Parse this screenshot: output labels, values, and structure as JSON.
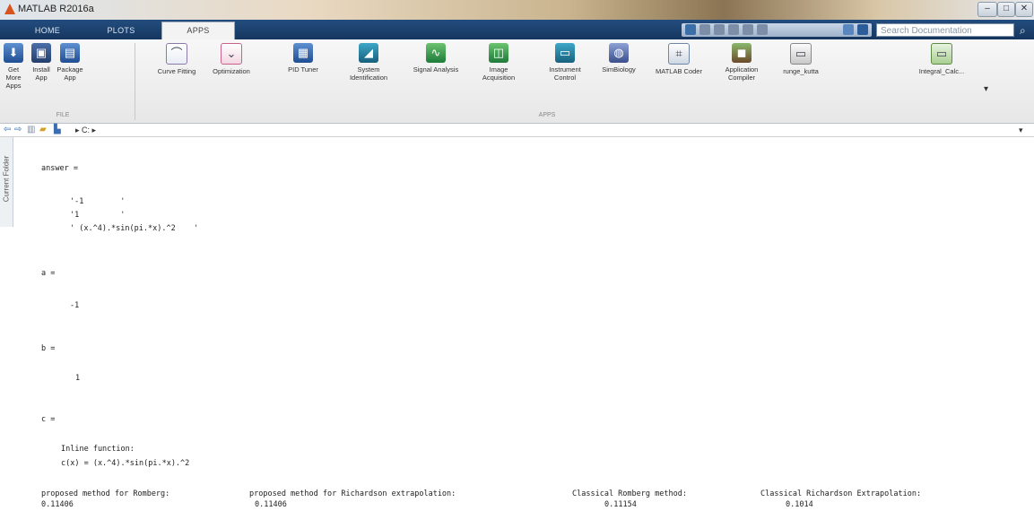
{
  "window": {
    "title": "MATLAB R2016a",
    "controls": [
      "–",
      "□",
      "✕"
    ]
  },
  "tabs": [
    {
      "label": "HOME",
      "active": false
    },
    {
      "label": "PLOTS",
      "active": false
    },
    {
      "label": "APPS",
      "active": true
    }
  ],
  "search": {
    "placeholder": "Search Documentation"
  },
  "ribbon": {
    "file_section_label": "FILE",
    "apps_section_label": "APPS",
    "buttons": [
      {
        "label": "Get More\nApps",
        "icon": "download-icon"
      },
      {
        "label": "Install\nApp",
        "icon": "install-icon"
      },
      {
        "label": "Package\nApp",
        "icon": "package-icon"
      },
      {
        "label": "Curve Fitting",
        "icon": "curve-fitting-icon"
      },
      {
        "label": "Optimization",
        "icon": "optimization-icon"
      },
      {
        "label": "PID Tuner",
        "icon": "pid-tuner-icon"
      },
      {
        "label": "System\nIdentification",
        "icon": "system-identification-icon"
      },
      {
        "label": "Signal Analysis",
        "icon": "signal-analysis-icon"
      },
      {
        "label": "Image\nAcquisition",
        "icon": "image-acquisition-icon"
      },
      {
        "label": "Instrument\nControl",
        "icon": "instrument-control-icon"
      },
      {
        "label": "SimBiology",
        "icon": "simbiology-icon"
      },
      {
        "label": "MATLAB Coder",
        "icon": "matlab-coder-icon"
      },
      {
        "label": "Application\nCompiler",
        "icon": "application-compiler-icon"
      },
      {
        "label": "runge_kutta",
        "icon": "runge-kutta-app-icon"
      },
      {
        "label": "Integral_Calc...",
        "icon": "integral-calc-app-icon"
      }
    ]
  },
  "address": {
    "path": "▸ C: ▸"
  },
  "side_panel": {
    "label": "Current Folder"
  },
  "command_window": {
    "lines": [
      "answer =",
      "'-1        '",
      "'1         '",
      "' (x.^4).*sin(pi.*x).^2    '",
      "a =",
      "-1",
      "b =",
      "1",
      "c =",
      "Inline function:",
      "c(x) = (x.^4).*sin(pi.*x).^2",
      "proposed method for Romberg:",
      "0.11406",
      "proposed method for Richardson extrapolation:",
      "0.11406",
      "Classical Romberg method:",
      "0.11154",
      "Classical Richardson Extrapolation:",
      "0.1014"
    ]
  }
}
